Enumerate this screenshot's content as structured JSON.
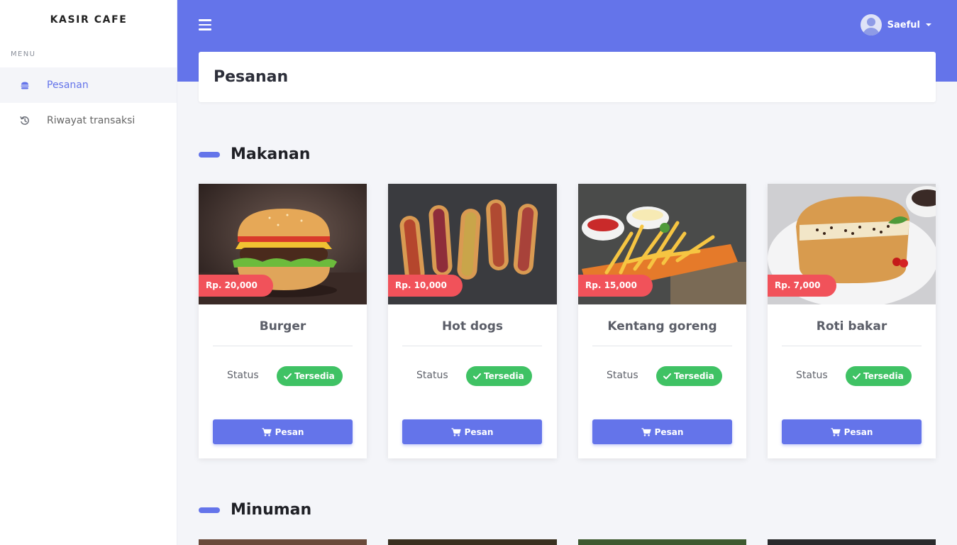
{
  "brand": "KASIR CAFE",
  "sidebar": {
    "heading": "MENU",
    "items": [
      {
        "label": "Pesanan",
        "icon": "burger-icon",
        "active": true
      },
      {
        "label": "Riwayat transaksi",
        "icon": "history-icon",
        "active": false
      }
    ]
  },
  "topbar": {
    "user_name": "Saeful"
  },
  "page": {
    "title": "Pesanan"
  },
  "sections": {
    "makanan": "Makanan",
    "minuman": "Minuman"
  },
  "foods": [
    {
      "name": "Burger",
      "price": "Rp. 20,000",
      "status_label": "Status",
      "status": "Tersedia",
      "button": "Pesan"
    },
    {
      "name": "Hot dogs",
      "price": "Rp. 10,000",
      "status_label": "Status",
      "status": "Tersedia",
      "button": "Pesan"
    },
    {
      "name": "Kentang goreng",
      "price": "Rp. 15,000",
      "status_label": "Status",
      "status": "Tersedia",
      "button": "Pesan"
    },
    {
      "name": "Roti bakar",
      "price": "Rp. 7,000",
      "status_label": "Status",
      "status": "Tersedia",
      "button": "Pesan"
    }
  ],
  "colors": {
    "accent": "#6474ea",
    "price_badge": "#f1525a",
    "status_available": "#3fc264",
    "background": "#f4f5f9"
  }
}
